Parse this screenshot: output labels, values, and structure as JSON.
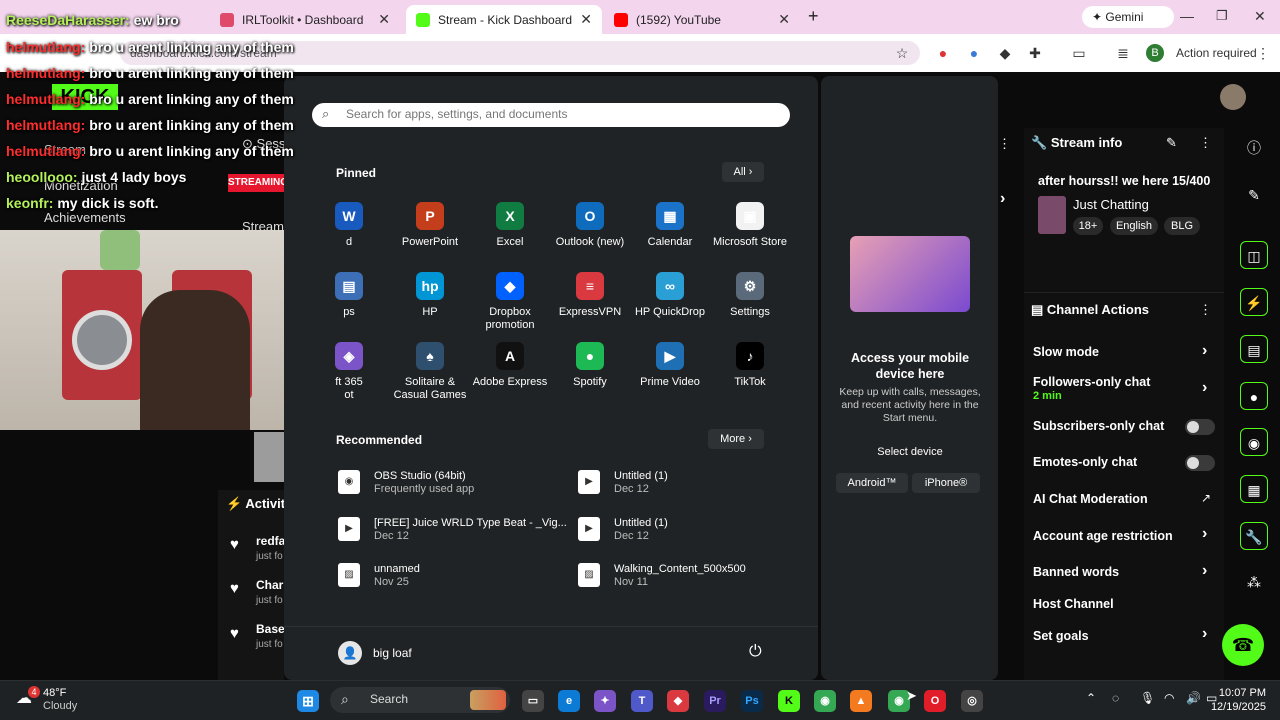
{
  "browser": {
    "tabs": [
      {
        "label": "IRLToolkit • Dashboard"
      },
      {
        "label": "Stream - Kick Dashboard"
      },
      {
        "label": "(1592) YouTube"
      }
    ],
    "new_tab": "+",
    "gemini": "Gemini",
    "address": "dashboard.kick.com/stream",
    "action_required": "Action required",
    "profile_letter": "B"
  },
  "kick": {
    "sidebar": {
      "session": "Session",
      "stream": "Stream",
      "monetization": "Monetization",
      "achievements": "Achievements",
      "streaming_badge": "STREAMING"
    },
    "activity": {
      "title": "Activity",
      "items": [
        {
          "name": "redfa",
          "sub": "just fo"
        },
        {
          "name": "Char",
          "sub": "just fo"
        },
        {
          "name": "Base",
          "sub": "just fo"
        }
      ]
    },
    "stream_info": {
      "title": "Stream info",
      "stream_title": "after hourss!! we here 15/400",
      "category": "Just Chatting",
      "tags": [
        "18+",
        "English",
        "BLG"
      ]
    },
    "channel_actions": {
      "title": "Channel Actions",
      "items": {
        "slow_mode": "Slow mode",
        "followers_only": "Followers-only chat",
        "followers_duration": "2 min",
        "subscribers_only": "Subscribers-only chat",
        "emotes_only": "Emotes-only chat",
        "ai_moderation": "AI Chat Moderation",
        "age_restriction": "Account age restriction",
        "banned_words": "Banned words",
        "host_channel": "Host Channel",
        "set_goals": "Set goals"
      }
    }
  },
  "chat_overlay": [
    {
      "user": "ReeseDaHarasser:",
      "msg": "ew bro"
    },
    {
      "user": "helmutlang:",
      "msg": "bro u arent linking any of them"
    },
    {
      "user": "helmutlang:",
      "msg": "bro u arent linking any of them"
    },
    {
      "user": "helmutlang:",
      "msg": "bro u arent linking any of them"
    },
    {
      "user": "helmutlang:",
      "msg": "bro u arent linking any of them"
    },
    {
      "user": "helmutlang:",
      "msg": "bro u arent linking any of them"
    },
    {
      "user": "heoollooo:",
      "msg": "just 4 lady boys"
    },
    {
      "user": "keonfr:",
      "msg": "my dick is soft."
    }
  ],
  "start_menu": {
    "search_placeholder": "Search for apps, settings, and documents",
    "pinned_label": "Pinned",
    "all_button": "All",
    "pinned_apps": [
      {
        "name": "d",
        "icon": "W",
        "color": "#185abd"
      },
      {
        "name": "PowerPoint",
        "icon": "P",
        "color": "#c43e1c"
      },
      {
        "name": "Excel",
        "icon": "X",
        "color": "#107c41"
      },
      {
        "name": "Outlook (new)",
        "icon": "O",
        "color": "#0f6cbd"
      },
      {
        "name": "Calendar",
        "icon": "▦",
        "color": "#1a73c9"
      },
      {
        "name": "Microsoft Store",
        "icon": "▣",
        "color": "#f2f2f2"
      },
      {
        "name": "ps",
        "icon": "▤",
        "color": "#3c6fb6"
      },
      {
        "name": "HP",
        "icon": "hp",
        "color": "#0096d6"
      },
      {
        "name": "Dropbox promotion",
        "icon": "◆",
        "color": "#0061fe"
      },
      {
        "name": "ExpressVPN",
        "icon": "≡",
        "color": "#da3940"
      },
      {
        "name": "HP QuickDrop",
        "icon": "∞",
        "color": "#2a9fd6"
      },
      {
        "name": "Settings",
        "icon": "⚙",
        "color": "#5a6a7a"
      },
      {
        "name": "ft 365\not",
        "icon": "◈",
        "color": "#7b55c8"
      },
      {
        "name": "Solitaire & Casual Games",
        "icon": "♠",
        "color": "#2f4f6f"
      },
      {
        "name": "Adobe Express",
        "icon": "A",
        "color": "#111111"
      },
      {
        "name": "Spotify",
        "icon": "●",
        "color": "#1db954"
      },
      {
        "name": "Prime Video",
        "icon": "▶",
        "color": "#1f6fb5"
      },
      {
        "name": "TikTok",
        "icon": "♪",
        "color": "#000000"
      }
    ],
    "recommended_label": "Recommended",
    "more_button": "More",
    "recommended": [
      {
        "title": "OBS Studio (64bit)",
        "sub": "Frequently used app",
        "icon": "◉"
      },
      {
        "title": "Untitled (1)",
        "sub": "Dec 12",
        "icon": "▶"
      },
      {
        "title": "[FREE] Juice WRLD Type Beat - _Vig...",
        "sub": "Dec 12",
        "icon": "▶"
      },
      {
        "title": "Untitled (1)",
        "sub": "Dec 12",
        "icon": "▶"
      },
      {
        "title": "unnamed",
        "sub": "Nov 25",
        "icon": "▨"
      },
      {
        "title": "Walking_Content_500x500",
        "sub": "Nov 11",
        "icon": "▨"
      }
    ],
    "user_name": "big loaf",
    "power_icon": "⏻"
  },
  "mobile_panel": {
    "title": "Access your mobile device here",
    "desc": "Keep up with calls, messages, and recent activity here in the Start menu.",
    "select_device": "Select device",
    "android": "Android™",
    "iphone": "iPhone®"
  },
  "taskbar": {
    "weather_temp": "48°F",
    "weather_cond": "Cloudy",
    "weather_badge": "4",
    "search_label": "Search",
    "time": "10:07 PM",
    "date": "12/19/2025"
  }
}
